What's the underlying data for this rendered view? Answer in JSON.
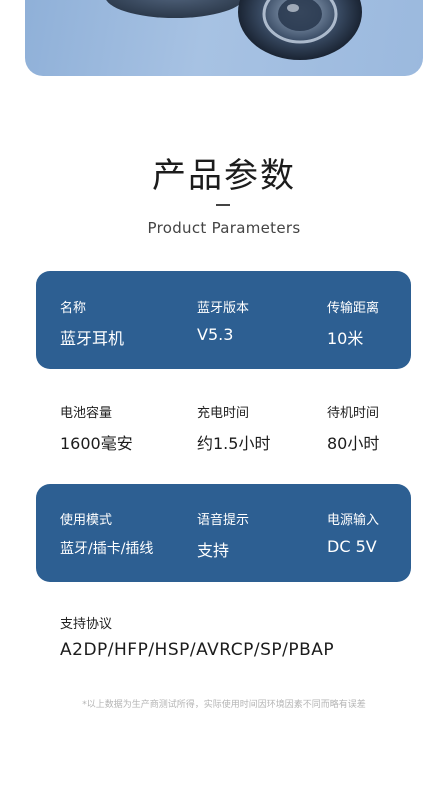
{
  "heading": {
    "title": "产品参数",
    "subtitle": "Product Parameters"
  },
  "rows": [
    {
      "style": "panel",
      "items": [
        {
          "label": "名称",
          "value": "蓝牙耳机"
        },
        {
          "label": "蓝牙版本",
          "value": "V5.3"
        },
        {
          "label": "传输距离",
          "value": "10米"
        }
      ]
    },
    {
      "style": "plain",
      "items": [
        {
          "label": "电池容量",
          "value": "1600毫安"
        },
        {
          "label": "充电时间",
          "value": "约1.5小时"
        },
        {
          "label": "待机时间",
          "value": "80小时"
        }
      ]
    },
    {
      "style": "panel",
      "items": [
        {
          "label": "使用模式",
          "value": "蓝牙/插卡/插线"
        },
        {
          "label": "语音提示",
          "value": "支持"
        },
        {
          "label": "电源输入",
          "value": "DC 5V"
        }
      ]
    }
  ],
  "protocol": {
    "label": "支持协议",
    "value": "A2DP/HFP/HSP/AVRCP/SP/PBAP"
  },
  "footnote": "*以上数据为生产商测试所得，实际使用时间因环境因素不同而略有误差",
  "colors": {
    "panel": "#2d5f92",
    "hero": "#9bb9de"
  }
}
